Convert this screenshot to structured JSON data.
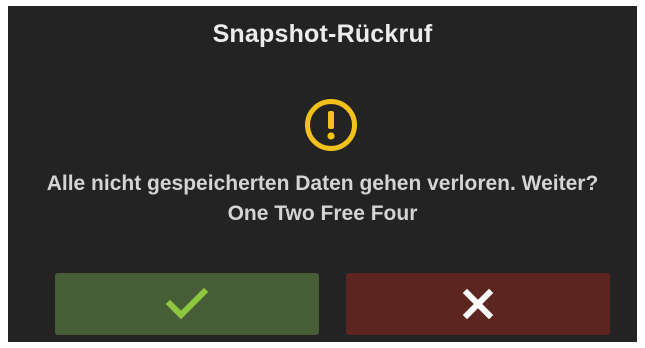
{
  "dialog": {
    "title": "Snapshot-Rückruf",
    "message_line1": "Alle nicht gespeicherten Daten gehen verloren. Weiter?",
    "message_line2": "One Two Free Four",
    "icon": "warning-icon"
  },
  "buttons": {
    "confirm_icon": "check-icon",
    "cancel_icon": "close-icon"
  },
  "colors": {
    "background": "#232323",
    "warning": "#f2c21b",
    "confirm": "#475d38",
    "confirm_icon": "#8ec63f",
    "cancel": "#5c2520",
    "cancel_icon": "#ffffff"
  }
}
